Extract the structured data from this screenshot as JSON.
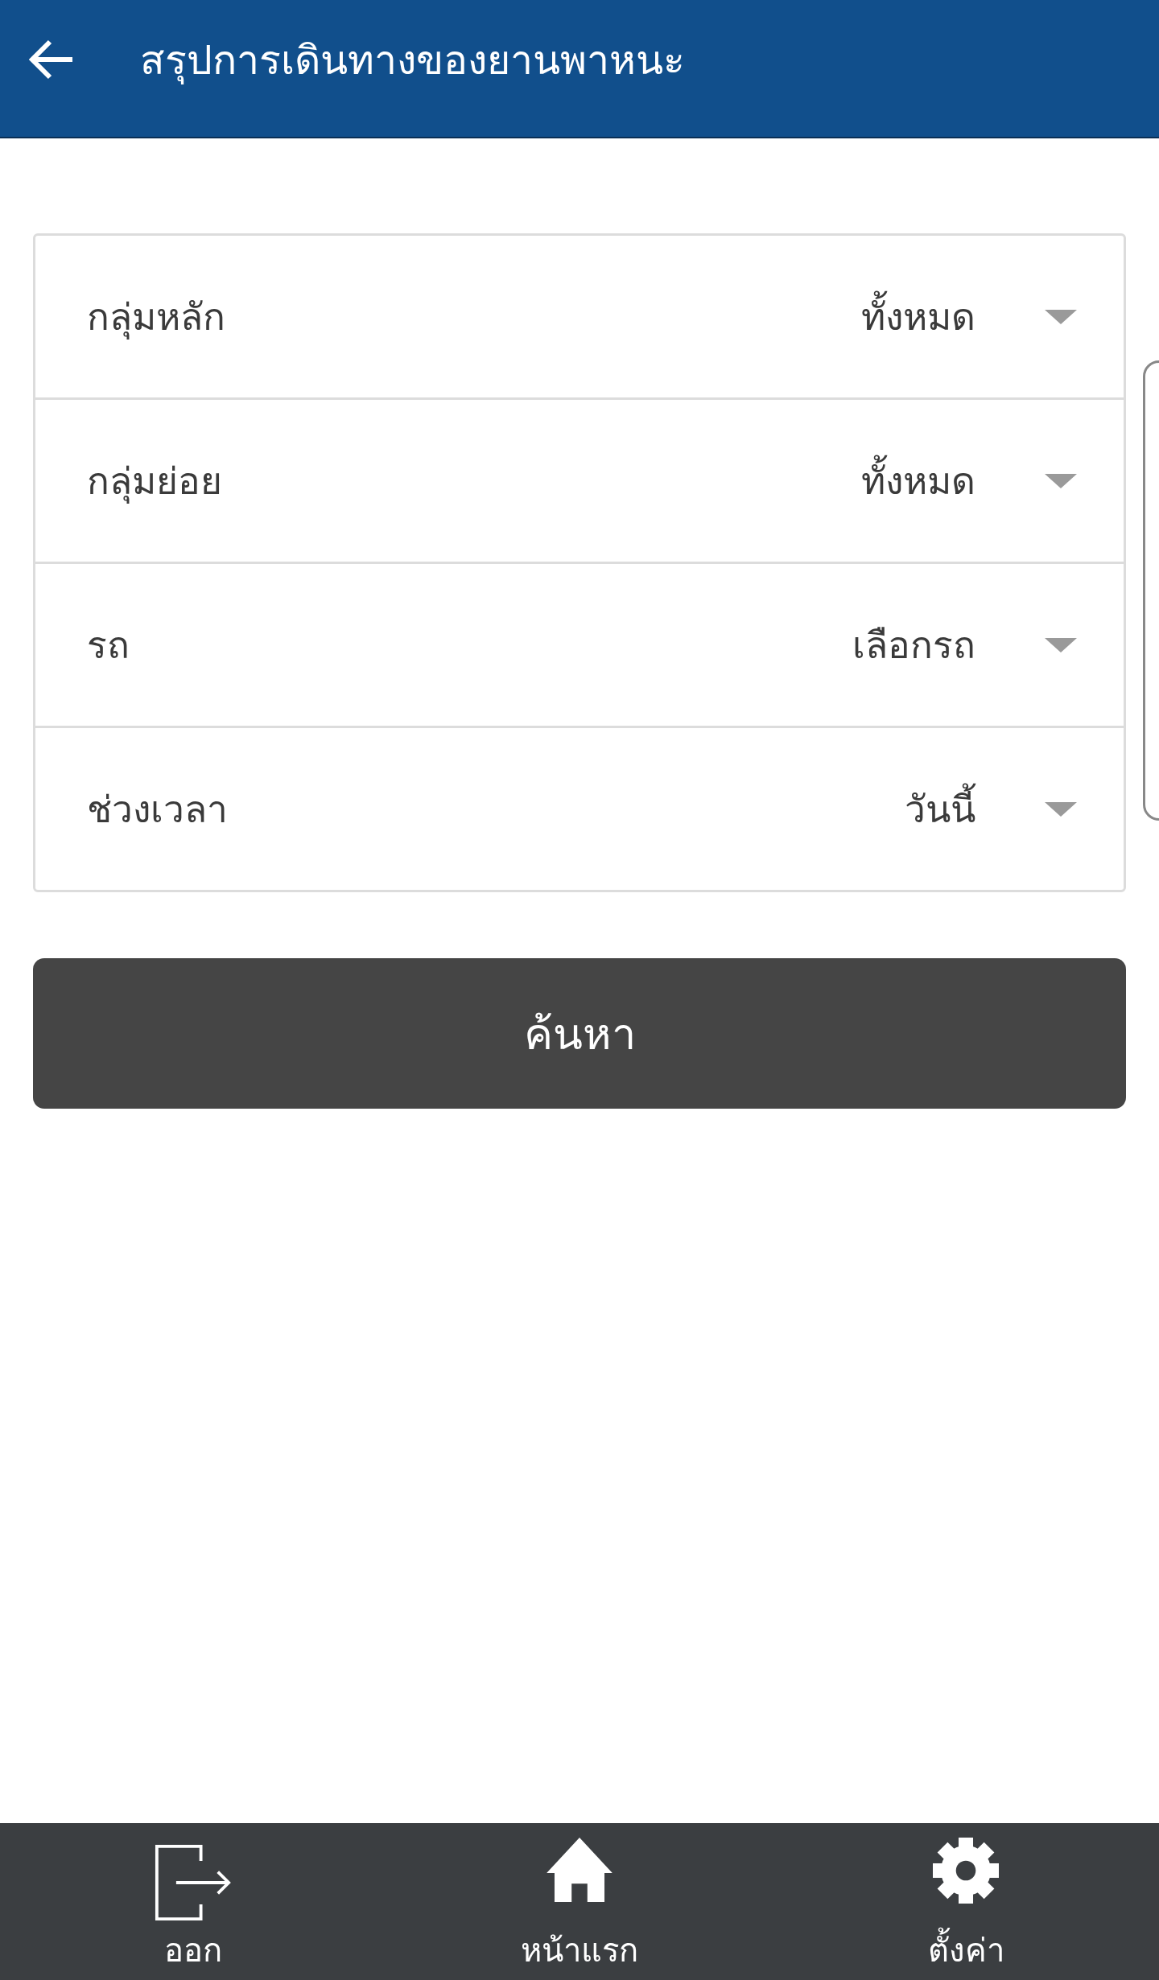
{
  "header": {
    "title": "สรุปการเดินทางของยานพาหนะ"
  },
  "filters": [
    {
      "label": "กลุ่มหลัก",
      "value": "ทั้งหมด"
    },
    {
      "label": "กลุ่มย่อย",
      "value": "ทั้งหมด"
    },
    {
      "label": "รถ",
      "value": "เลือกรถ"
    },
    {
      "label": "ช่วงเวลา",
      "value": "วันนี้"
    }
  ],
  "search_button": {
    "label": "ค้นหา"
  },
  "bottom_nav": [
    {
      "kind": "exit",
      "label": "ออก"
    },
    {
      "kind": "home",
      "label": "หน้าแรก"
    },
    {
      "kind": "settings",
      "label": "ตั้งค่า"
    }
  ]
}
